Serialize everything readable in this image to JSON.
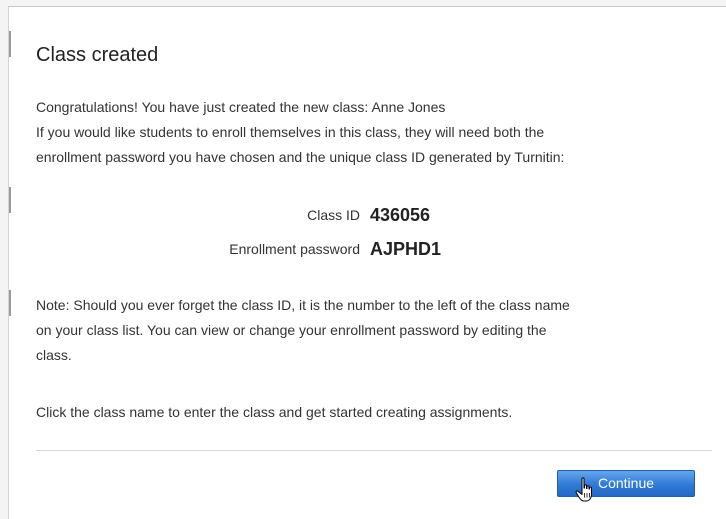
{
  "dialog": {
    "title": "Class created",
    "intro_lines": [
      "Congratulations! You have just created the new class: Anne Jones",
      "If you would like students to enroll themselves in this class, they will need both the",
      "enrollment password you have chosen and the unique class ID generated by Turnitin:"
    ],
    "class_id_label": "Class ID",
    "class_id_value": "436056",
    "enrollment_password_label": "Enrollment password",
    "enrollment_password_value": "AJPHD1",
    "note_lines": [
      "Note: Should you ever forget the class ID, it is the number to the left of the class name",
      "on your class list. You can view or change your enrollment password by editing the",
      "class."
    ],
    "call_to_action": "Click the class name to enter the class and get started creating assignments.",
    "continue_label": "Continue"
  },
  "cursor_icon": "hand-pointer-icon",
  "colors": {
    "button_blue": "#2f7ad8",
    "text": "#333333"
  }
}
